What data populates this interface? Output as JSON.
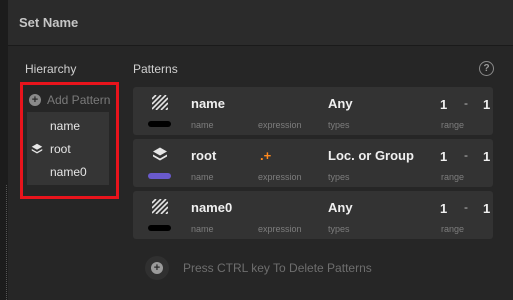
{
  "window": {
    "title": "Set Name"
  },
  "hierarchy": {
    "label": "Hierarchy",
    "add_pattern_label": "Add Pattern",
    "items": [
      {
        "label": "name",
        "icon": "none"
      },
      {
        "label": "root",
        "icon": "layers-icon"
      },
      {
        "label": "name0",
        "icon": "none"
      }
    ]
  },
  "patterns": {
    "label": "Patterns",
    "help_icon": "?",
    "captions": {
      "name": "name",
      "expression": "expression",
      "types": "types",
      "range": "range"
    },
    "rows": [
      {
        "name": "name",
        "expression": "",
        "types": "Any",
        "range_min": "1",
        "range_sep": "-",
        "range_max": "1",
        "icon": "hatch-icon",
        "color": "#000000"
      },
      {
        "name": "root",
        "expression": ".+",
        "types": "Loc. or Group",
        "range_min": "1",
        "range_sep": "-",
        "range_max": "1",
        "icon": "layers-icon",
        "color": "#6a5acd"
      },
      {
        "name": "name0",
        "expression": "",
        "types": "Any",
        "range_min": "1",
        "range_sep": "-",
        "range_max": "1",
        "icon": "hatch-icon",
        "color": "#000000"
      }
    ]
  },
  "footer": {
    "hint": "Press CTRL key To Delete Patterns"
  }
}
